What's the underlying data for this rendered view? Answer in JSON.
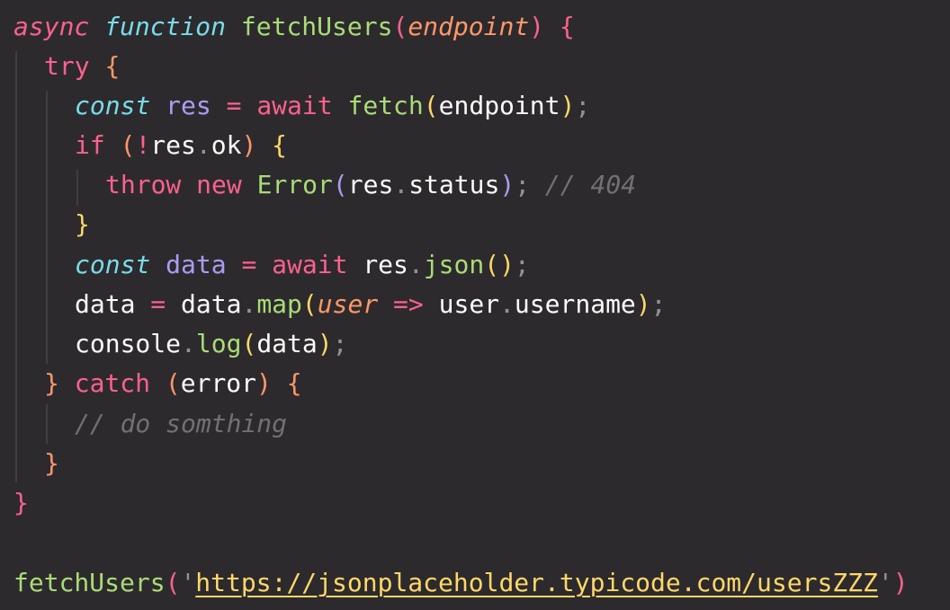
{
  "editor": {
    "language": "javascript",
    "theme_colors": {
      "background": "#2d2a2e",
      "keyword": "#fc618d",
      "storage_type": "#78dce8",
      "function": "#a9dc76",
      "parameter": "#fc9867",
      "variable": "#ab9df2",
      "string": "#ffd866",
      "comment": "#727072",
      "text": "#fcfcfa"
    },
    "lines": [
      [
        "async",
        " ",
        "function",
        " ",
        "fetchUsers",
        "(",
        "endpoint",
        ")",
        " ",
        "{"
      ],
      [
        "try",
        " ",
        "{"
      ],
      [
        "const",
        " ",
        "res",
        " ",
        "=",
        " ",
        "await",
        " ",
        "fetch",
        "(",
        "endpoint",
        ")",
        ";"
      ],
      [
        "if",
        " ",
        "(",
        "!",
        "res",
        ".",
        "ok",
        ")",
        " ",
        "{"
      ],
      [
        "throw",
        " ",
        "new",
        " ",
        "Error",
        "(",
        "res",
        ".",
        "status",
        ")",
        ";",
        " ",
        "// 404"
      ],
      [
        "}"
      ],
      [
        "const",
        " ",
        "data",
        " ",
        "=",
        " ",
        "await",
        " ",
        "res",
        ".",
        "json",
        "(",
        ")",
        ";"
      ],
      [
        "data",
        " ",
        "=",
        " ",
        "data",
        ".",
        "map",
        "(",
        "user",
        " ",
        "=>",
        " ",
        "user",
        ".",
        "username",
        ")",
        ";"
      ],
      [
        "console",
        ".",
        "log",
        "(",
        "data",
        ")",
        ";"
      ],
      [
        "}",
        " ",
        "catch",
        " ",
        "(",
        "error",
        ")",
        " ",
        "{"
      ],
      [
        "// do somthing"
      ],
      [
        "}"
      ],
      [
        "}"
      ],
      [
        "fetchUsers",
        "(",
        "'",
        "https://jsonplaceholder.typicode.com/usersZZZ",
        "'",
        ")"
      ]
    ]
  }
}
